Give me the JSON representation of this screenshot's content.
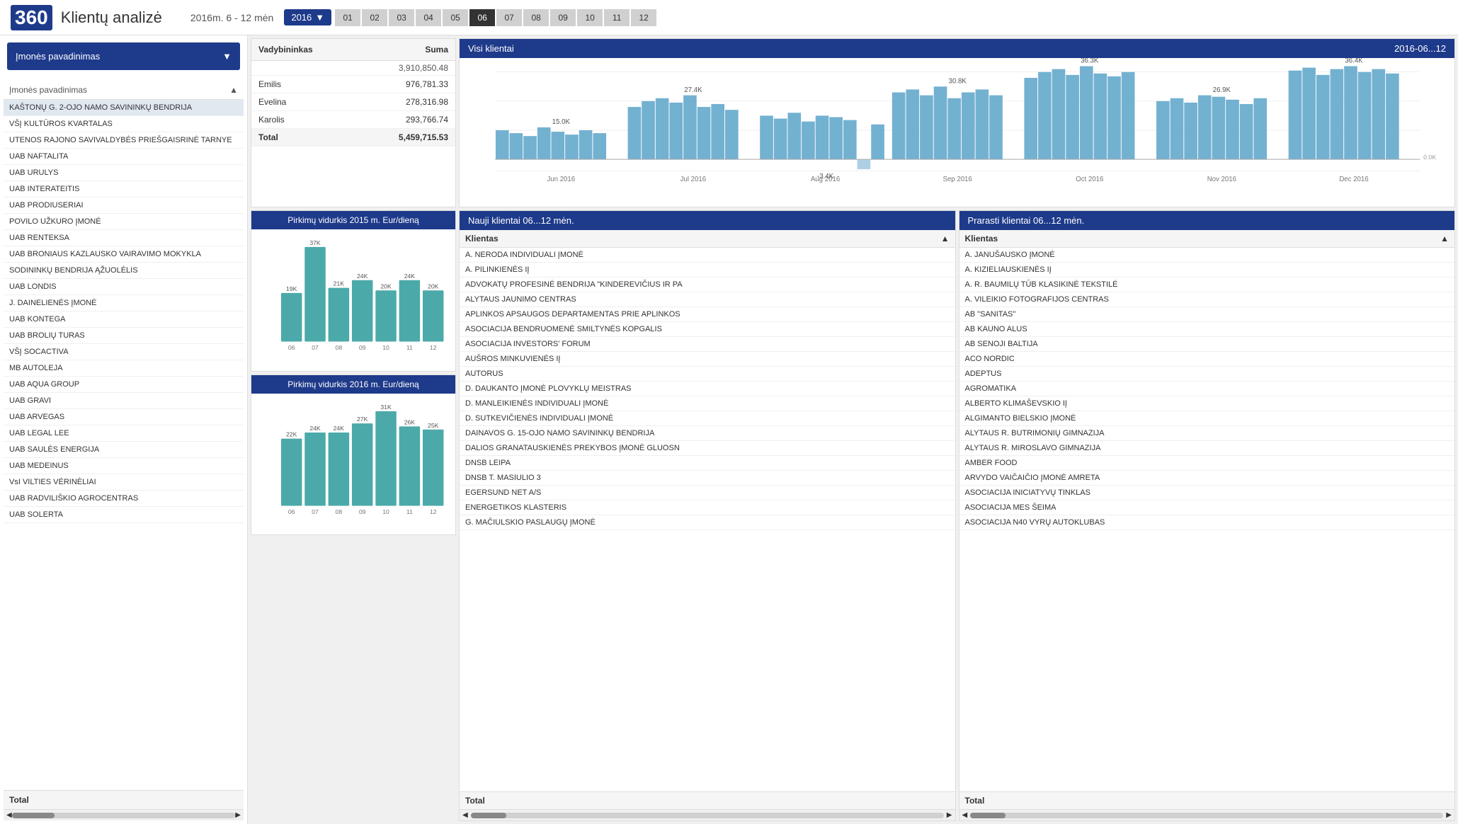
{
  "header": {
    "logo": "360",
    "title": "Klientų analizė",
    "date_range": "2016m. 6 - 12 mėn",
    "year": "2016",
    "months": [
      "01",
      "02",
      "03",
      "04",
      "05",
      "06",
      "07",
      "08",
      "09",
      "10",
      "11",
      "12"
    ],
    "active_months": [
      "06",
      "07",
      "08",
      "09",
      "10",
      "11",
      "12"
    ]
  },
  "left_panel": {
    "dropdown_label": "Įmonės pavadinimas",
    "list_header": "Įmonės pavadinimas",
    "companies": [
      "KAŠTONŲ G. 2-OJO NAMO SAVININKŲ BENDRIJA",
      "VŠĮ KULTŪROS KVARTALAS",
      "UTENOS RAJONO SAVIVALDYBĖS PRIEŠGAISRINĖ TARNYE",
      "UAB NAFTALITA",
      "UAB URULYS",
      "UAB INTERATEITIS",
      "UAB PRODIUSERIAI",
      "POVILO UŽKURO ĮMONĖ",
      "UAB RENTEKSA",
      "UAB BRONIAUS KAZLAUSKO VAIRAVIMO MOKYKLA",
      "SODININKŲ BENDRIJA ĄŽUOLĖLIS",
      "UAB LONDIS",
      "J. DAINELIENĖS ĮMONĖ",
      "UAB KONTEGA",
      "UAB BROLIŲ TURAS",
      "VŠĮ SOCACTIVA",
      "MB AUTOLEJA",
      "UAB AQUA GROUP",
      "UAB GRAVI",
      "UAB ARVEGAS",
      "UAB LEGAL LEE",
      "UAB SAULĖS ENERGIJA",
      "UAB MEDEINUS",
      "VsI VILTIES VĖRINĖLIAI",
      "UAB RADVILIŠKIO AGROCENTRAS",
      "UAB SOLERTA"
    ],
    "total_label": "Total",
    "selected_index": 0
  },
  "vadybininkas_table": {
    "col1": "Vadybininkas",
    "col2": "Suma",
    "subtotal": "3,910,850.48",
    "rows": [
      {
        "name": "Emilis",
        "amount": "976,781.33"
      },
      {
        "name": "Evelina",
        "amount": "278,316.98"
      },
      {
        "name": "Karolis",
        "amount": "293,766.74"
      }
    ],
    "total_label": "Total",
    "total_amount": "5,459,715.53"
  },
  "main_chart": {
    "title": "Visi klientai",
    "date_range": "2016-06...12",
    "labels": [
      "Jun 2016",
      "Jul 2016",
      "Aug 2016",
      "Sep 2016",
      "Oct 2016",
      "Nov 2016",
      "Dec 2016"
    ],
    "values_label": [
      "15.0K",
      "27.4K",
      "",
      "30.8K",
      "36.3K",
      "",
      "26.9K",
      "",
      "36.4K"
    ],
    "negative_label": "-3.4K",
    "zero_label": "0.0K",
    "bar_data": [
      {
        "label": "Jun 2016",
        "value": 150,
        "negative": false
      },
      {
        "label": "Jul 2016",
        "value": 274,
        "negative": false
      },
      {
        "label": "Aug 2016",
        "value": 220,
        "negative": false
      },
      {
        "label": "Sep 2016",
        "value": 308,
        "negative": false
      },
      {
        "label": "Oct 2016",
        "value": 363,
        "negative": false
      },
      {
        "label": "Nov 2016",
        "value": 269,
        "negative": false
      },
      {
        "label": "Dec 2016",
        "value": 364,
        "negative": false
      }
    ]
  },
  "chart_2015": {
    "title": "Pirkimų vidurkis 2015 m. Eur/dieną",
    "bars": [
      {
        "label": "06",
        "value": 19,
        "display": "19K"
      },
      {
        "label": "07",
        "value": 37,
        "display": "37K"
      },
      {
        "label": "08",
        "value": 21,
        "display": "21K"
      },
      {
        "label": "09",
        "value": 24,
        "display": "24K"
      },
      {
        "label": "10",
        "value": 20,
        "display": "20K"
      },
      {
        "label": "11",
        "value": 24,
        "display": "24K"
      },
      {
        "label": "12",
        "value": 20,
        "display": "20K"
      }
    ],
    "color": "#4ca9a9"
  },
  "chart_2016": {
    "title": "Pirkimų vidurkis 2016 m. Eur/dieną",
    "bars": [
      {
        "label": "06",
        "value": 22,
        "display": "22K"
      },
      {
        "label": "07",
        "value": 24,
        "display": "24K"
      },
      {
        "label": "08",
        "value": 24,
        "display": "24K"
      },
      {
        "label": "09",
        "value": 27,
        "display": "27K"
      },
      {
        "label": "10",
        "value": 31,
        "display": "31K"
      },
      {
        "label": "11",
        "value": 26,
        "display": "26K"
      },
      {
        "label": "12",
        "value": 25,
        "display": "25K"
      }
    ],
    "color": "#4ca9a9"
  },
  "new_clients": {
    "title": "Nauji klientai  06...12 mėn.",
    "col_label": "Klientas",
    "clients": [
      "A. NERODA INDIVIDUALI ĮMONĖ",
      "A. PILINKIENĖS IĮ",
      "ADVOKATŲ PROFESINĖ BENDRIJA \"KINDEREVIČIUS IR PA",
      "ALYTAUS JAUNIMO CENTRAS",
      "APLINKOS APSAUGOS DEPARTAMENTAS PRIE APLINKOS",
      "ASOCIACIJA BENDRUOMENĖ SMILTYNĖS KOPGALIS",
      "ASOCIACIJA INVESTORS' FORUM",
      "AUŠROS MINKUVIENĖS IĮ",
      "AUTORUS",
      "D. DAUKANTO ĮMONĖ PLOVYKLŲ MEISTRAS",
      "D. MANLEIKIENĖS INDIVIDUALI ĮMONĖ",
      "D. SUTKEVIČIENĖS INDIVIDUALI ĮMONĖ",
      "DAINAVOS G. 15-OJO NAMO SAVININKŲ BENDRIJA",
      "DALIOS GRANATAUSKIENĖS PREKYBOS ĮMONĖ GLUOSN",
      "DNSB LEIPA",
      "DNSB T. MASIULIO 3",
      "EGERSUND NET A/S",
      "ENERGETIKOS KLASTERIS",
      "G. MAČIULSKIO PASLAUGŲ ĮMONĖ"
    ],
    "total_label": "Total"
  },
  "lost_clients": {
    "title": "Prarasti klientai  06...12 mėn.",
    "col_label": "Klientas",
    "clients": [
      "A. JANUŠAUSKO ĮMONĖ",
      "A. KIZIELIAUSKIENĖS IĮ",
      "A. R. BAUMILŲ TŪB KLASIKINĖ TEKSTILĖ",
      "A. VILEIKIO FOTOGRAFIJOS CENTRAS",
      "AB \"SANITAS\"",
      "AB KAUNO ALUS",
      "AB SENOJI BALTIJA",
      "ACO NORDIC",
      "ADEPTUS",
      "AGROMATIKA",
      "ALBERTO KLIMAŠEVSKIO IĮ",
      "ALGIMANTO BIELSKIO ĮMONĖ",
      "ALYTAUS R. BUTRIMONIŲ GIMNAZIJA",
      "ALYTAUS R. MIROSLAVO GIMNAZIJA",
      "AMBER FOOD",
      "ARVYDO VAIČAIČIO ĮMONĖ AMRETA",
      "ASOCIACIJA INICIATYVŲ TINKLAS",
      "ASOCIACIJA MES ŠEIMA",
      "ASOCIACIJA N40 VYRŲ AUTOKLUBAS"
    ],
    "total_label": "Total"
  }
}
